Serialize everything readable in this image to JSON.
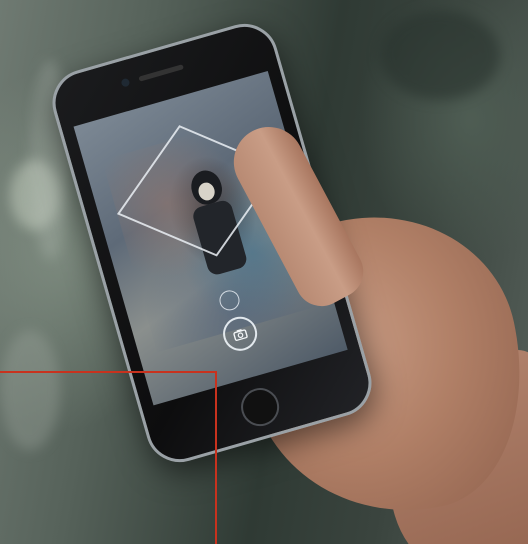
{
  "scene": {
    "icons": [
      "camera-icon"
    ],
    "colors": {
      "background": "#56625a",
      "skin": "#b07f66",
      "phone_body": "#111111",
      "phone_frame": "#9aa1a6",
      "annotation_line": "#c8321e"
    }
  }
}
